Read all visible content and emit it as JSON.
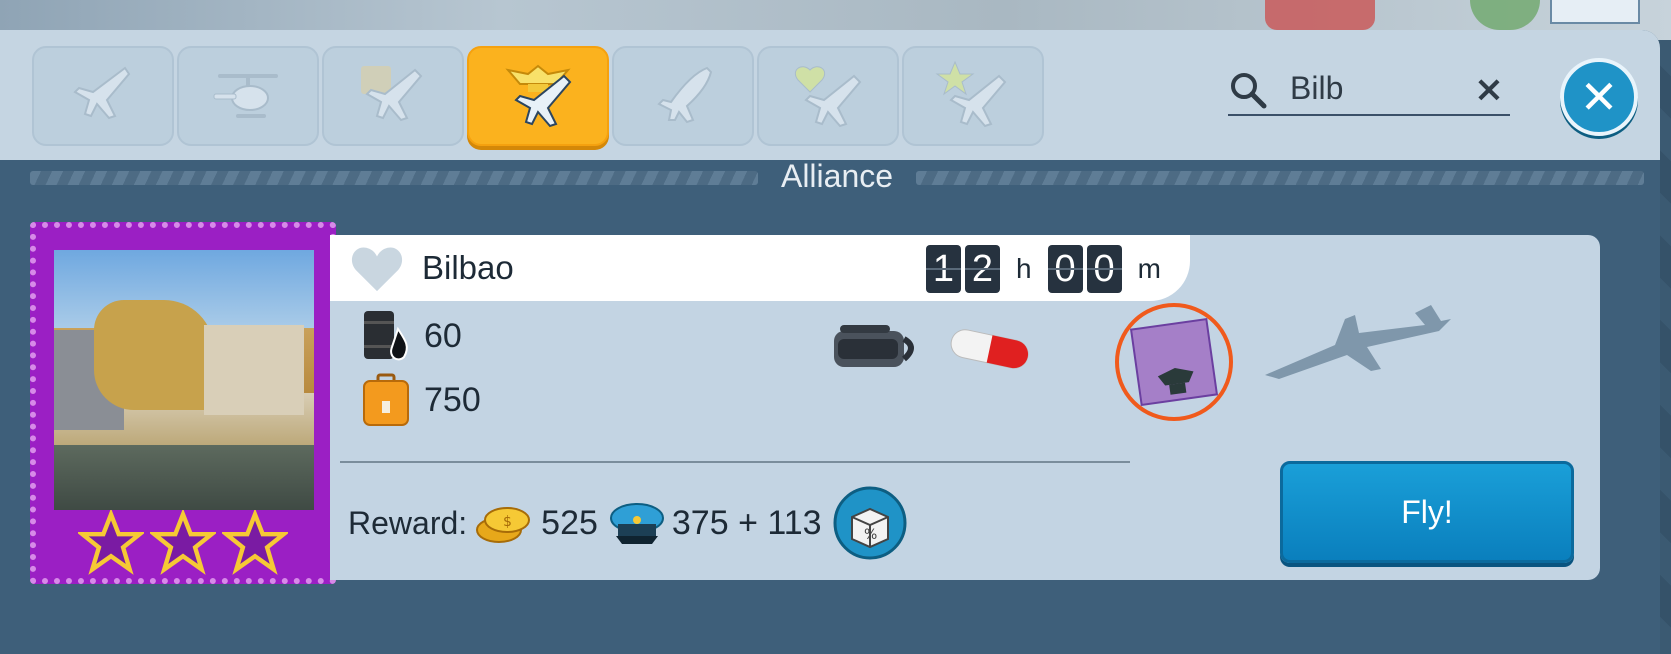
{
  "tabs": [
    {
      "name": "all-planes",
      "active": false
    },
    {
      "name": "helicopter",
      "active": false
    },
    {
      "name": "map-plane",
      "active": false
    },
    {
      "name": "alliance",
      "active": true
    },
    {
      "name": "rocket-plane",
      "active": false
    },
    {
      "name": "favorite-plane",
      "active": false
    },
    {
      "name": "star-plane",
      "active": false
    }
  ],
  "search": {
    "value": "Bilb",
    "clear_label": "×"
  },
  "close_label": "✕",
  "section": {
    "title": "Alliance"
  },
  "mission": {
    "destination": "Bilbao",
    "timer": {
      "hours_d1": "1",
      "hours_d2": "2",
      "hours_unit": "h",
      "mins_d1": "0",
      "mins_d2": "0",
      "mins_unit": "m"
    },
    "fuel": "60",
    "cargo": "750",
    "reward_label": "Reward:",
    "reward_coins": "525",
    "reward_xp": "375 + 113",
    "fly_label": "Fly!",
    "stars": 3
  },
  "colors": {
    "accent": "#fbb21e",
    "button": "#1a9fd8",
    "stamp": "#9b1fc4",
    "boost_ring": "#f05a1c"
  }
}
